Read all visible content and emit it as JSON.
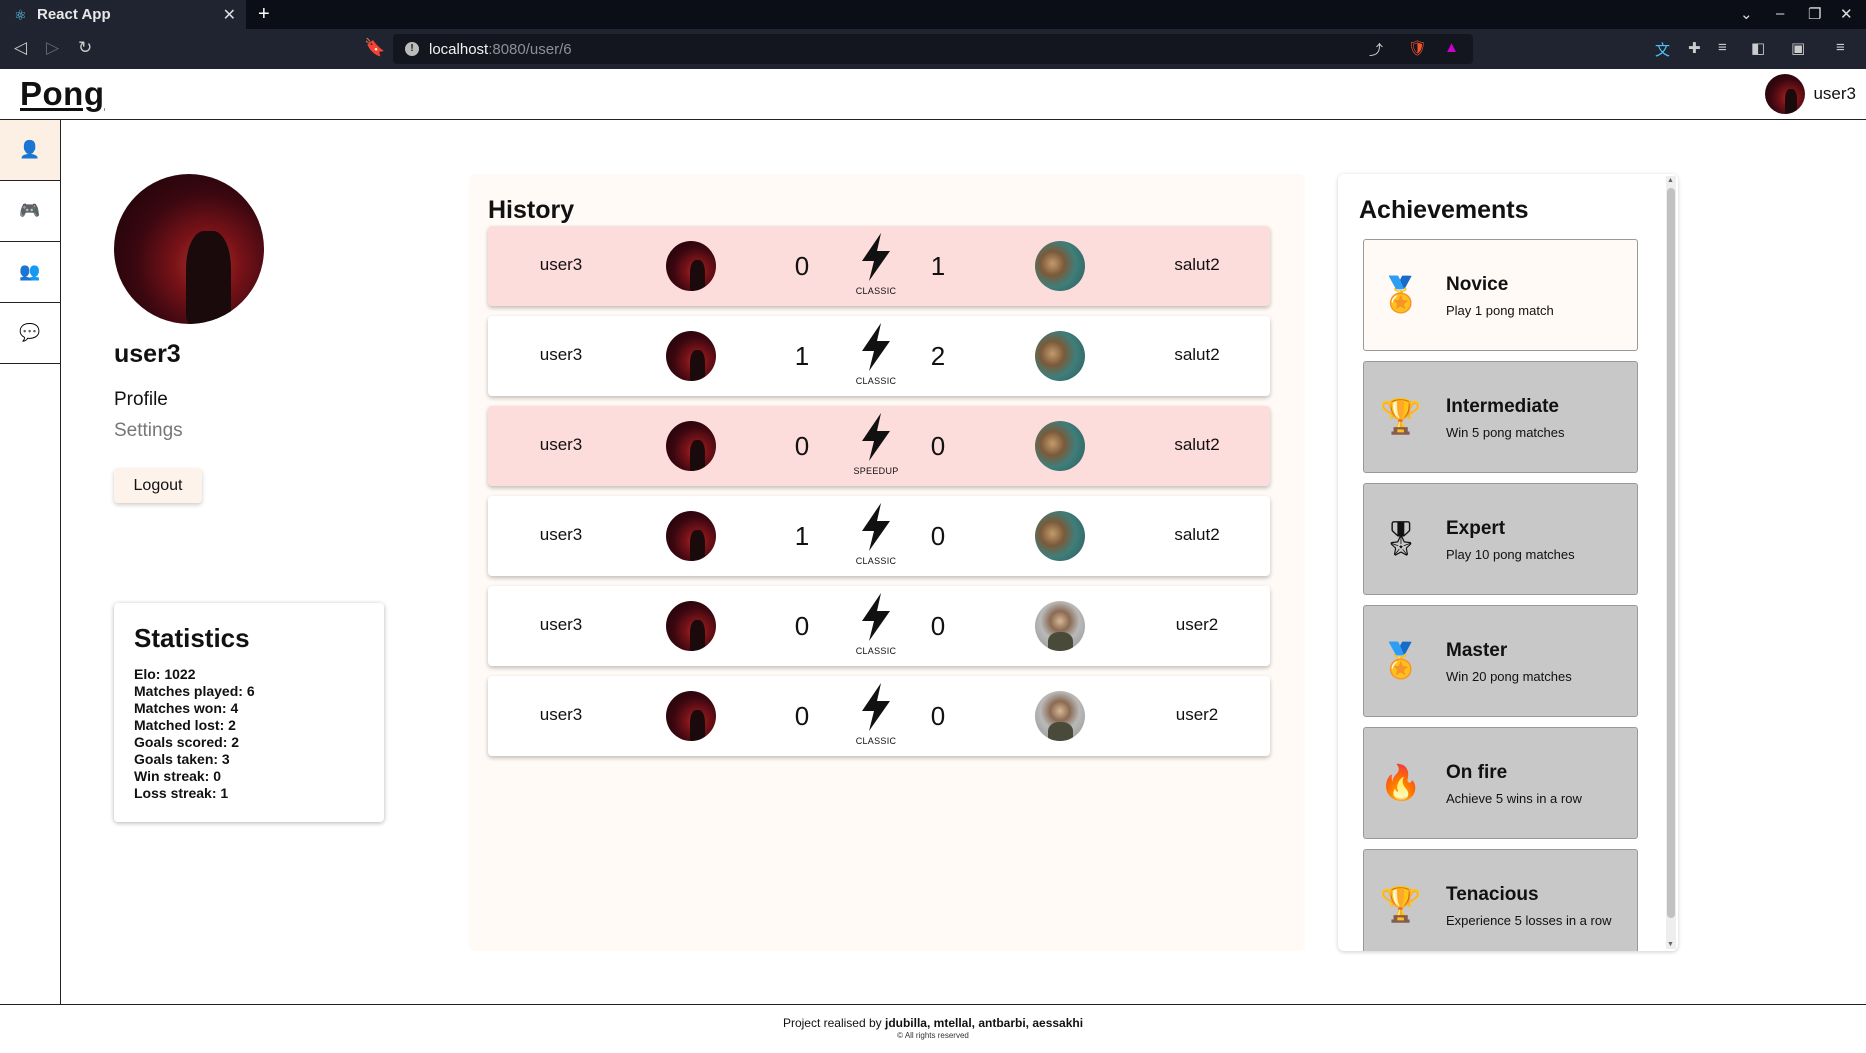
{
  "browser": {
    "tab_title": "React App",
    "tab_close": "✕",
    "new_tab": "+",
    "url_host": "localhost",
    "url_path": ":8080/user/6"
  },
  "header": {
    "logo": "Pong",
    "username": "user3"
  },
  "sidebar": {
    "items": [
      {
        "icon": "user-icon",
        "glyph": "👤"
      },
      {
        "icon": "gamepad-icon",
        "glyph": "🎮"
      },
      {
        "icon": "friends-icon",
        "glyph": "👥"
      },
      {
        "icon": "chat-icon",
        "glyph": "💬"
      }
    ]
  },
  "profile": {
    "username": "user3",
    "links": [
      "Profile",
      "Settings"
    ],
    "logout_label": "Logout"
  },
  "statistics": {
    "title": "Statistics",
    "lines": [
      "Elo: 1022",
      "Matches played: 6",
      "Matches won: 4",
      "Matched lost: 2",
      "Goals scored: 2",
      "Goals taken: 3",
      "Win streak: 0",
      "Loss streak: 1"
    ]
  },
  "history": {
    "title": "History",
    "matches": [
      {
        "player1": "user3",
        "score1": "0",
        "mode": "CLASSIC",
        "score2": "1",
        "player2": "salut2",
        "result": "loss"
      },
      {
        "player1": "user3",
        "score1": "1",
        "mode": "CLASSIC",
        "score2": "2",
        "player2": "salut2",
        "result": "other"
      },
      {
        "player1": "user3",
        "score1": "0",
        "mode": "SPEEDUP",
        "score2": "0",
        "player2": "salut2",
        "result": "loss"
      },
      {
        "player1": "user3",
        "score1": "1",
        "mode": "CLASSIC",
        "score2": "0",
        "player2": "salut2",
        "result": "other"
      },
      {
        "player1": "user3",
        "score1": "0",
        "mode": "CLASSIC",
        "score2": "0",
        "player2": "user2",
        "result": "other"
      },
      {
        "player1": "user3",
        "score1": "0",
        "mode": "CLASSIC",
        "score2": "0",
        "player2": "user2",
        "result": "other"
      }
    ]
  },
  "achievements": {
    "title": "Achievements",
    "items": [
      {
        "title": "Novice",
        "description": "Play 1 pong match",
        "icon": "medal-icon",
        "glyph": "🏅",
        "unlocked": true
      },
      {
        "title": "Intermediate",
        "description": "Win 5 pong matches",
        "icon": "trophy-icon",
        "glyph": "🏆",
        "unlocked": false
      },
      {
        "title": "Expert",
        "description": "Play 10 pong matches",
        "icon": "medal-icon",
        "glyph": "🎖",
        "unlocked": false
      },
      {
        "title": "Master",
        "description": "Win 20 pong matches",
        "icon": "medal-icon",
        "glyph": "🏅",
        "unlocked": false
      },
      {
        "title": "On fire",
        "description": "Achieve 5 wins in a row",
        "icon": "fire-icon",
        "glyph": "🔥",
        "unlocked": false
      },
      {
        "title": "Tenacious",
        "description": "Experience 5 losses in a row",
        "icon": "podium-icon",
        "glyph": "🏆",
        "unlocked": false
      }
    ]
  },
  "footer": {
    "prefix": "Project realised by ",
    "authors": "jdubilla, mtellal, antbarbi, aessakhi",
    "rights": "© All rights reserved"
  }
}
